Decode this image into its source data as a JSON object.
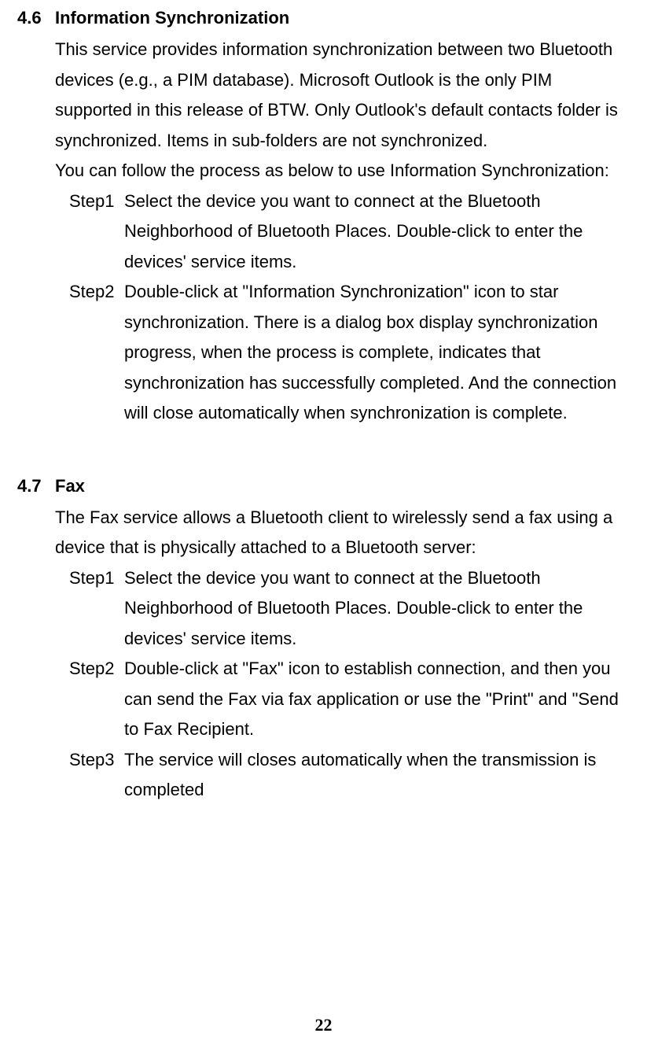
{
  "sections": [
    {
      "number": "4.6",
      "title": "Information Synchronization",
      "intro": [
        "This service provides information synchronization between two Bluetooth devices (e.g., a PIM database). Microsoft Outlook is the only PIM supported in this release of BTW. Only Outlook's default contacts folder is synchronized. Items in sub-folders are not synchronized.",
        "You can follow the process as below to use Information Synchronization:"
      ],
      "steps": [
        {
          "label": "Step1",
          "text": "Select the device you want to connect at the Bluetooth Neighborhood of Bluetooth Places. Double-click to enter the devices' service items."
        },
        {
          "label": "Step2",
          "text": "Double-click at \"Information Synchronization\" icon to star synchronization. There is a dialog box display synchronization progress, when the process is complete, indicates that synchronization has successfully completed. And the connection will close automatically when synchronization is complete."
        }
      ]
    },
    {
      "number": "4.7",
      "title": "Fax",
      "intro": [
        "The Fax service allows a Bluetooth client to wirelessly send a fax using a device that is physically attached to a Bluetooth server:"
      ],
      "steps": [
        {
          "label": "Step1",
          "text": "Select the device you want to connect at the Bluetooth Neighborhood of Bluetooth Places. Double-click to enter the devices' service items."
        },
        {
          "label": "Step2",
          "text": "Double-click at \"Fax\" icon to establish connection, and then you can send the Fax via fax application or use the \"Print\" and \"Send to Fax Recipient."
        },
        {
          "label": "Step3",
          "text": "The service will closes automatically when the transmission is completed"
        }
      ]
    }
  ],
  "page_number": "22"
}
